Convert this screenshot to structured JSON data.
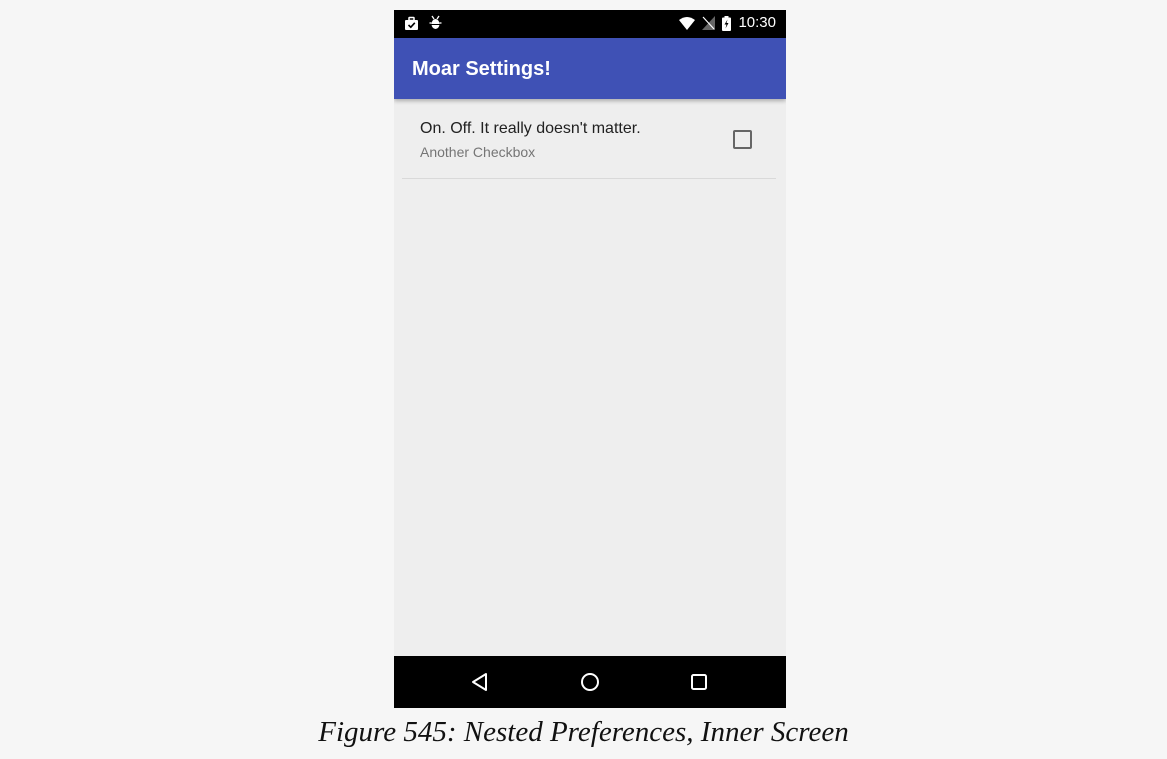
{
  "status_bar": {
    "time": "10:30",
    "icons": [
      "briefcase-check-icon",
      "android-debug-icon",
      "wifi-icon",
      "no-signal-icon",
      "battery-charging-icon"
    ]
  },
  "app_bar": {
    "title": "Moar Settings!",
    "color": "#3f51b5"
  },
  "preferences": [
    {
      "title": "On. Off. It really doesn't matter.",
      "summary": "Another Checkbox",
      "checked": false
    }
  ],
  "nav_bar": {
    "buttons": [
      "back-icon",
      "home-icon",
      "recents-icon"
    ]
  },
  "caption": "Figure 545: Nested Preferences, Inner Screen"
}
